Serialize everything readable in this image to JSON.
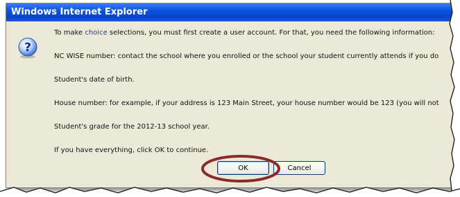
{
  "window": {
    "title": "Windows Internet Explorer"
  },
  "message": {
    "line1_pre": "To make ",
    "line1_link": "choice",
    "line1_post": " selections, you must first create a user account. For that, you need the following information:",
    "line2": "NC WISE number: contact the school where you enrolled or the school your student currently attends if you do",
    "line3": "Student's date of birth.",
    "line4": "House number: for example, if your address is 123 Main Street, your house number would be 123 (you will not",
    "line5": "Student's grade for the 2012-13 school year.",
    "line6": "If you have everything, click OK to continue."
  },
  "buttons": {
    "ok": "OK",
    "cancel": "Cancel"
  },
  "colors": {
    "titlebar": "#0a53de",
    "dialog_bg": "#ece9d8",
    "highlight_ring": "#8b2a2a",
    "link": "#1a3e9a"
  },
  "icons": {
    "dialog_icon": "question-icon"
  }
}
